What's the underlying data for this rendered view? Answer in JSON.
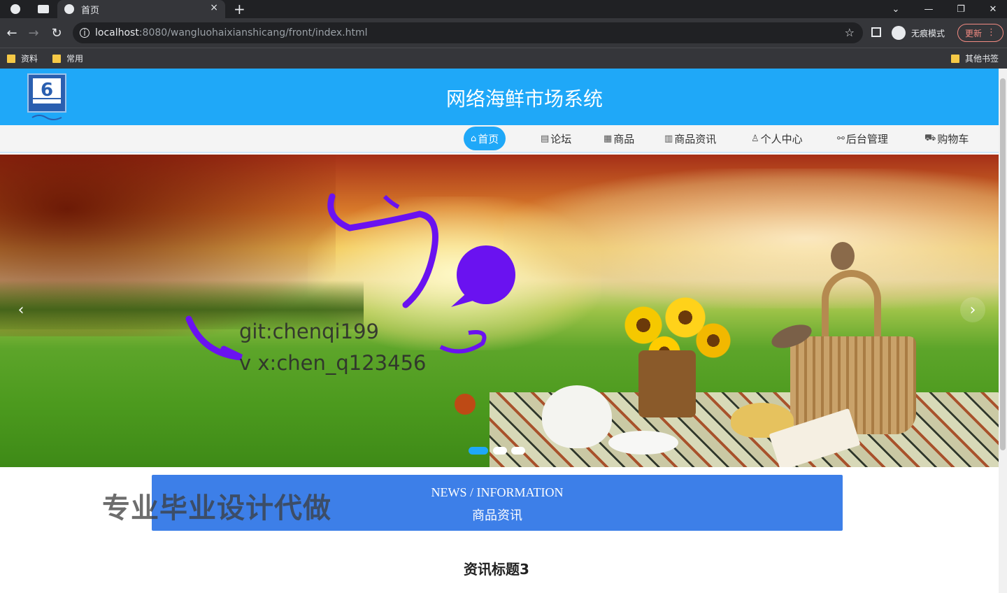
{
  "browser": {
    "tab": {
      "title": "首页",
      "close": "×"
    },
    "new_tab": "+",
    "window": {
      "dropdown": "⌄",
      "minimize": "—",
      "restore": "❐",
      "close": "✕"
    },
    "nav": {
      "back": "←",
      "forward": "→",
      "reload": "↻"
    },
    "address": {
      "host": "localhost",
      "path": ":8080/wangluohaixianshicang/front/index.html",
      "star": "☆"
    },
    "incognito_label": "无痕模式",
    "update_label": "更新",
    "update_menu": "⋮",
    "bookmarks": [
      "资料",
      "常用"
    ],
    "other_bookmarks": "其他书签"
  },
  "site": {
    "title": "网络海鲜市场系统",
    "menu": [
      {
        "icon": "⌂",
        "label": "首页",
        "active": true
      },
      {
        "icon": "▤",
        "label": "论坛",
        "active": false
      },
      {
        "icon": "▦",
        "label": "商品",
        "active": false
      },
      {
        "icon": "▥",
        "label": "商品资讯",
        "active": false
      },
      {
        "icon": "♙",
        "label": "个人中心",
        "active": false
      },
      {
        "icon": "⚯",
        "label": "后台管理",
        "active": false
      },
      {
        "icon": "⛟",
        "label": "购物车",
        "active": false
      }
    ]
  },
  "banner": {
    "prev": "‹",
    "next": "›",
    "overlay_line1": "git:chenqi199",
    "overlay_line2": "v x:chen_q123456",
    "active_slide": 1,
    "slide_count": 3,
    "overlay_color": "#6a12f0"
  },
  "news": {
    "en": "NEWS / INFORMATION",
    "zh": "商品资讯"
  },
  "watermark": "专业毕业设计代做",
  "article_title": "资讯标题3",
  "colors": {
    "header": "#1fa8f8",
    "news_bar": "#3d7fe8",
    "accent": "#1fa8f8"
  }
}
